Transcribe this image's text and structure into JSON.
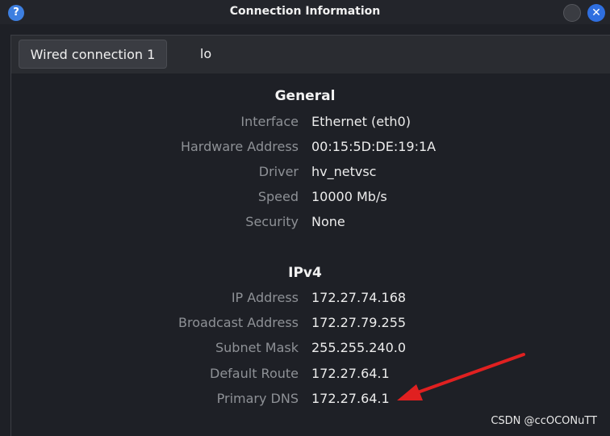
{
  "window": {
    "title": "Connection Information",
    "help_glyph": "?",
    "close_glyph": "✕"
  },
  "tabs": [
    {
      "label": "Wired connection 1",
      "active": true
    },
    {
      "label": "lo",
      "active": false
    }
  ],
  "general": {
    "heading": "General",
    "rows": [
      {
        "label": "Interface",
        "value": "Ethernet (eth0)"
      },
      {
        "label": "Hardware Address",
        "value": "00:15:5D:DE:19:1A"
      },
      {
        "label": "Driver",
        "value": "hv_netvsc"
      },
      {
        "label": "Speed",
        "value": "10000 Mb/s"
      },
      {
        "label": "Security",
        "value": "None"
      }
    ]
  },
  "ipv4": {
    "heading": "IPv4",
    "rows": [
      {
        "label": "IP Address",
        "value": "172.27.74.168"
      },
      {
        "label": "Broadcast Address",
        "value": "172.27.79.255"
      },
      {
        "label": "Subnet Mask",
        "value": "255.255.240.0"
      },
      {
        "label": "Default Route",
        "value": "172.27.64.1"
      },
      {
        "label": "Primary DNS",
        "value": "172.27.64.1"
      }
    ]
  },
  "annotation": {
    "color": "#e02020"
  },
  "watermark": "CSDN @ccOCONuTT",
  "colors": {
    "accent": "#3d7fe0",
    "label": "#8e9196",
    "value": "#ececec",
    "background": "#1e2026"
  }
}
